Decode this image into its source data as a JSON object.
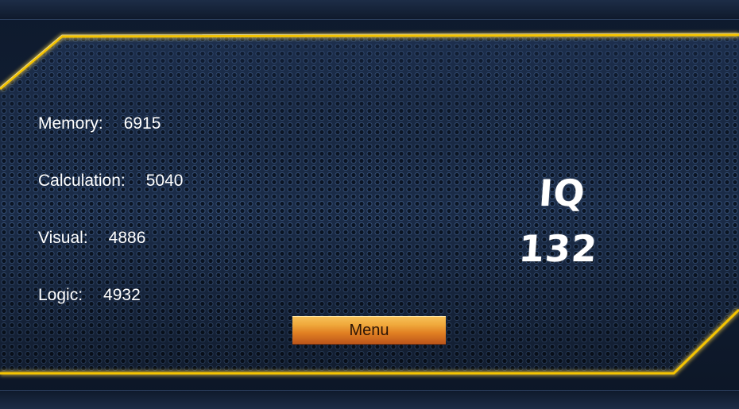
{
  "stats": [
    {
      "label": "Memory:",
      "value": "6915"
    },
    {
      "label": "Calculation:",
      "value": "5040"
    },
    {
      "label": "Visual:",
      "value": "4886"
    },
    {
      "label": "Logic:",
      "value": "4932"
    }
  ],
  "iq": {
    "label": "IQ",
    "value": "132"
  },
  "menu": {
    "label": "Menu"
  },
  "colors": {
    "frame_gold": "#f5c400",
    "panel_blue": "#1a2a44",
    "button_orange": "#e07f22",
    "text": "#ffffff"
  }
}
